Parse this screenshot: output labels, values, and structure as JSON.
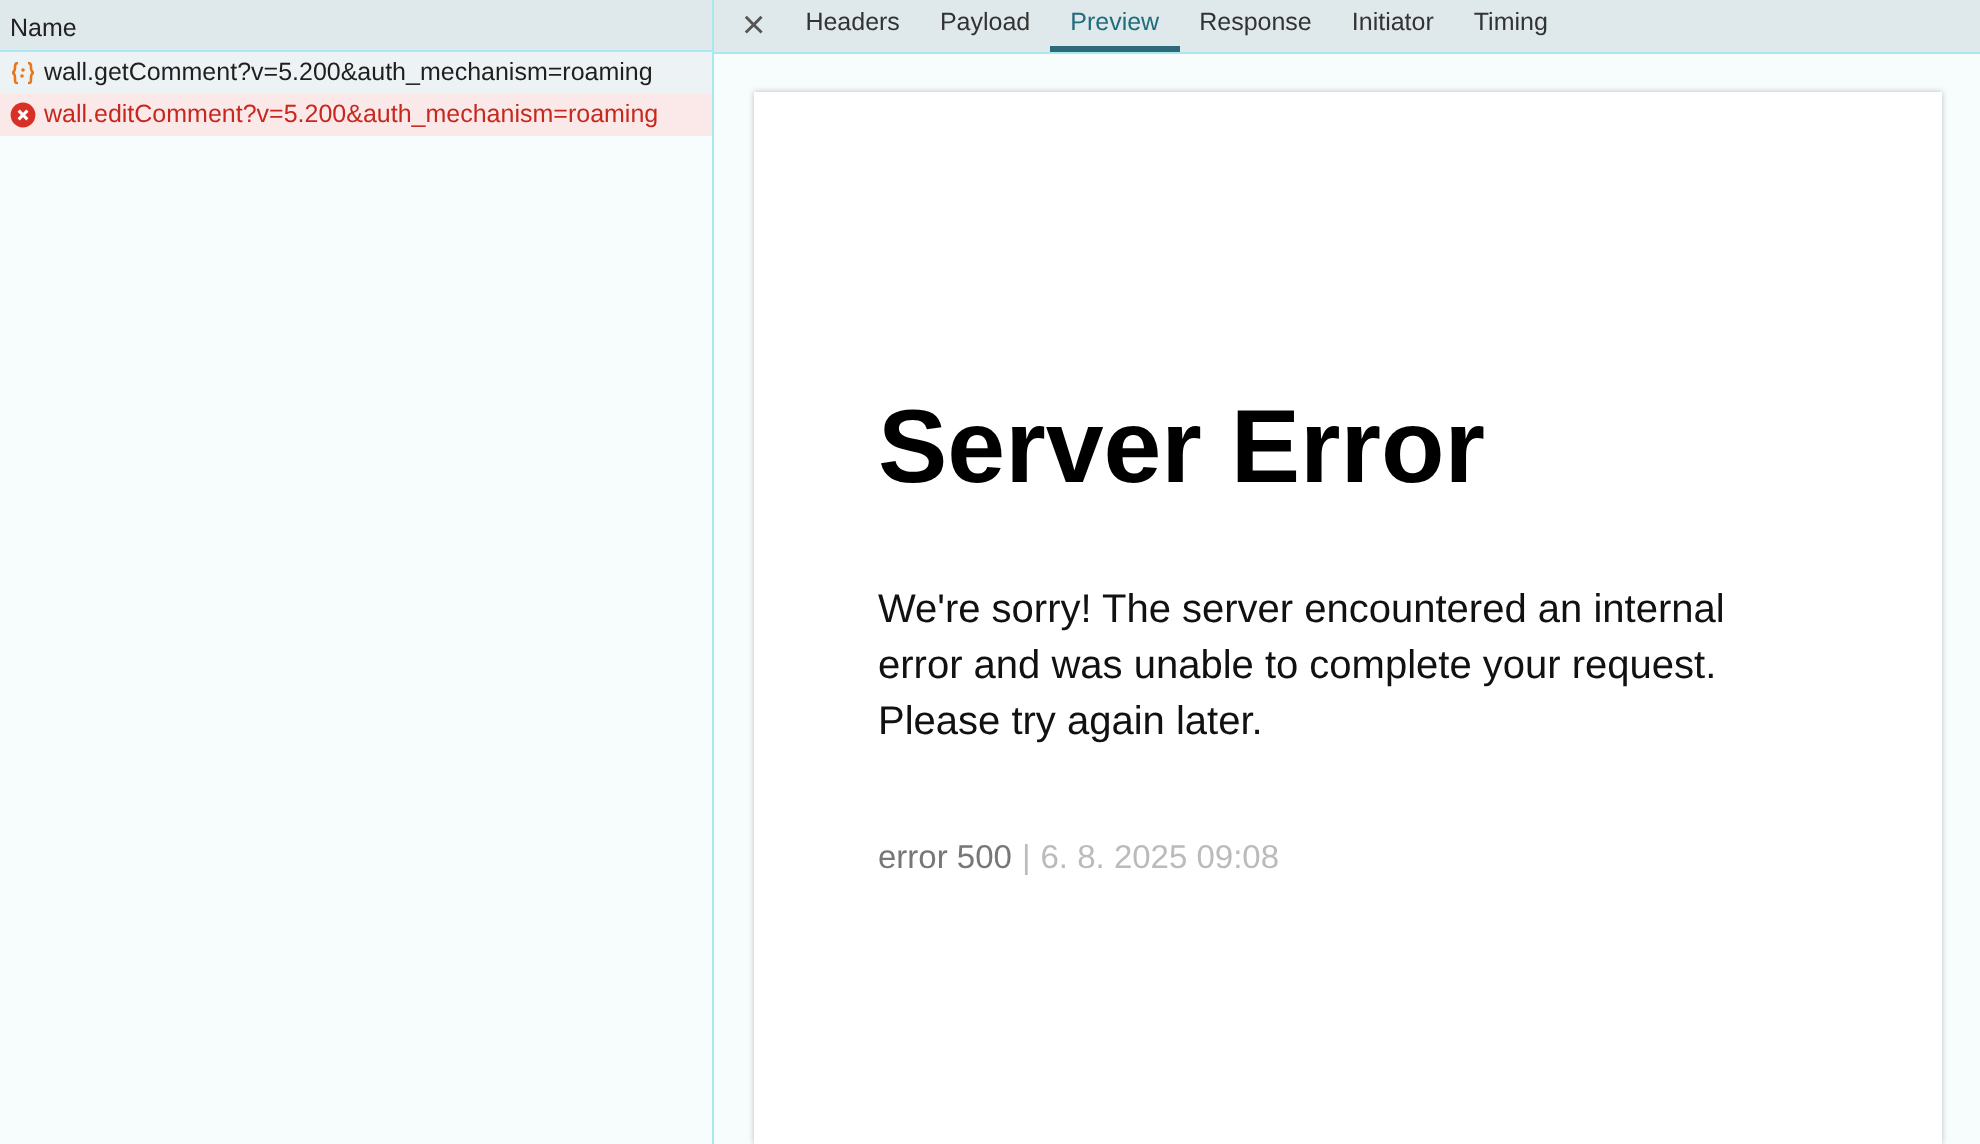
{
  "requests": {
    "column": "Name",
    "rows": [
      {
        "name": "wall.getComment?v=5.200&auth_mechanism=roaming",
        "kind": "json"
      },
      {
        "name": "wall.editComment?v=5.200&auth_mechanism=roaming",
        "kind": "error"
      }
    ]
  },
  "details": {
    "close": "×",
    "tabs": [
      {
        "label": "Headers",
        "selected": false
      },
      {
        "label": "Payload",
        "selected": false
      },
      {
        "label": "Preview",
        "selected": true
      },
      {
        "label": "Response",
        "selected": false
      },
      {
        "label": "Initiator",
        "selected": false
      },
      {
        "label": "Timing",
        "selected": false
      }
    ]
  },
  "preview": {
    "title": "Server Error",
    "message": "We're sorry! The server encountered an internal error and was unable to complete your request. Please try again later.",
    "code": "error 500",
    "separator": "|",
    "date": "6. 8. 2025 09:08"
  }
}
